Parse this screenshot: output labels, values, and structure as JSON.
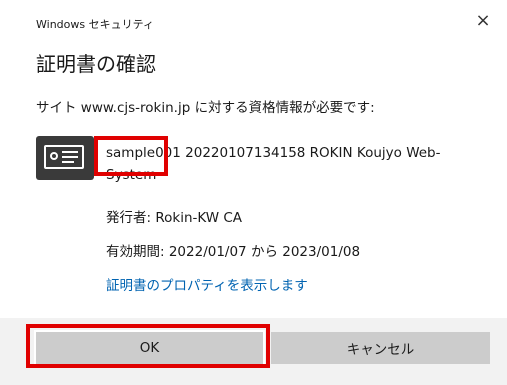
{
  "window": {
    "title": "Windows セキュリティ",
    "close_glyph": "×"
  },
  "dialog": {
    "heading": "証明書の確認",
    "prompt": "サイト www.cjs-rokin.jp に対する資格情報が必要です:"
  },
  "certificate": {
    "icon": "certificate-icon",
    "name": "sample001 20220107134158 ROKIN Koujyo Web-System",
    "issuer": "発行者: Rokin-KW CA",
    "validity": "有効期間: 2022/01/07 から 2023/01/08",
    "properties_link": "証明書のプロパティを表示します"
  },
  "buttons": {
    "ok_label": "OK",
    "cancel_label": "キャンセル"
  },
  "colors": {
    "link": "#0063b1",
    "highlight": "#e00000",
    "button_bg": "#cccccc",
    "footer_bg": "#f2f2f2"
  }
}
